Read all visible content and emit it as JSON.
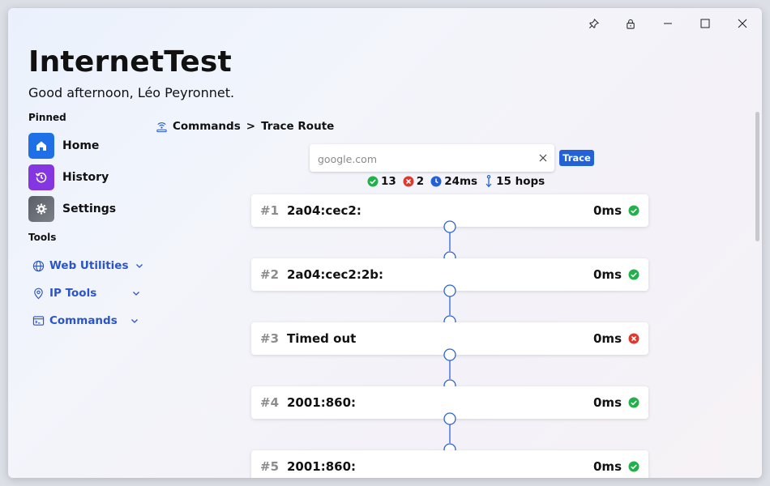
{
  "app": {
    "title": "InternetTest",
    "greeting": "Good afternoon, Léo Peyronnet."
  },
  "titlebar": {
    "buttons": [
      "pin-icon",
      "lock-icon",
      "minimize-icon",
      "maximize-icon",
      "close-icon"
    ]
  },
  "sidebar": {
    "pinned_label": "Pinned",
    "pinned": [
      {
        "label": "Home",
        "icon": "home-icon",
        "color": "#1f6fe6"
      },
      {
        "label": "History",
        "icon": "history-icon",
        "color": "#8436e0"
      },
      {
        "label": "Settings",
        "icon": "gear-icon",
        "color": "#62666e"
      }
    ],
    "tools_label": "Tools",
    "tools": [
      {
        "label": "Web Utilities",
        "icon": "globe-icon"
      },
      {
        "label": "IP Tools",
        "icon": "location-icon"
      },
      {
        "label": "Commands",
        "icon": "commands-icon"
      }
    ]
  },
  "breadcrumb": {
    "section": "Commands",
    "separator": ">",
    "page": "Trace Route"
  },
  "search": {
    "placeholder": "google.com",
    "value": ""
  },
  "trace_button": "Trace",
  "stats": {
    "success": "13",
    "failed": "2",
    "time": "24ms",
    "hops": "15 hops"
  },
  "hops": [
    {
      "num": "#1",
      "address": "2a04:cec2:",
      "time": "0ms",
      "status": "success"
    },
    {
      "num": "#2",
      "address": "2a04:cec2:2b:",
      "time": "0ms",
      "status": "success"
    },
    {
      "num": "#3",
      "address": "Timed out",
      "time": "0ms",
      "status": "error"
    },
    {
      "num": "#4",
      "address": "2001:860:",
      "time": "0ms",
      "status": "success"
    },
    {
      "num": "#5",
      "address": "2001:860:",
      "time": "0ms",
      "status": "success"
    }
  ],
  "colors": {
    "accent": "#2262d6",
    "link": "#2a55c8",
    "success": "#22b04a",
    "error": "#e0382e",
    "timeline": "#2f64d0"
  }
}
